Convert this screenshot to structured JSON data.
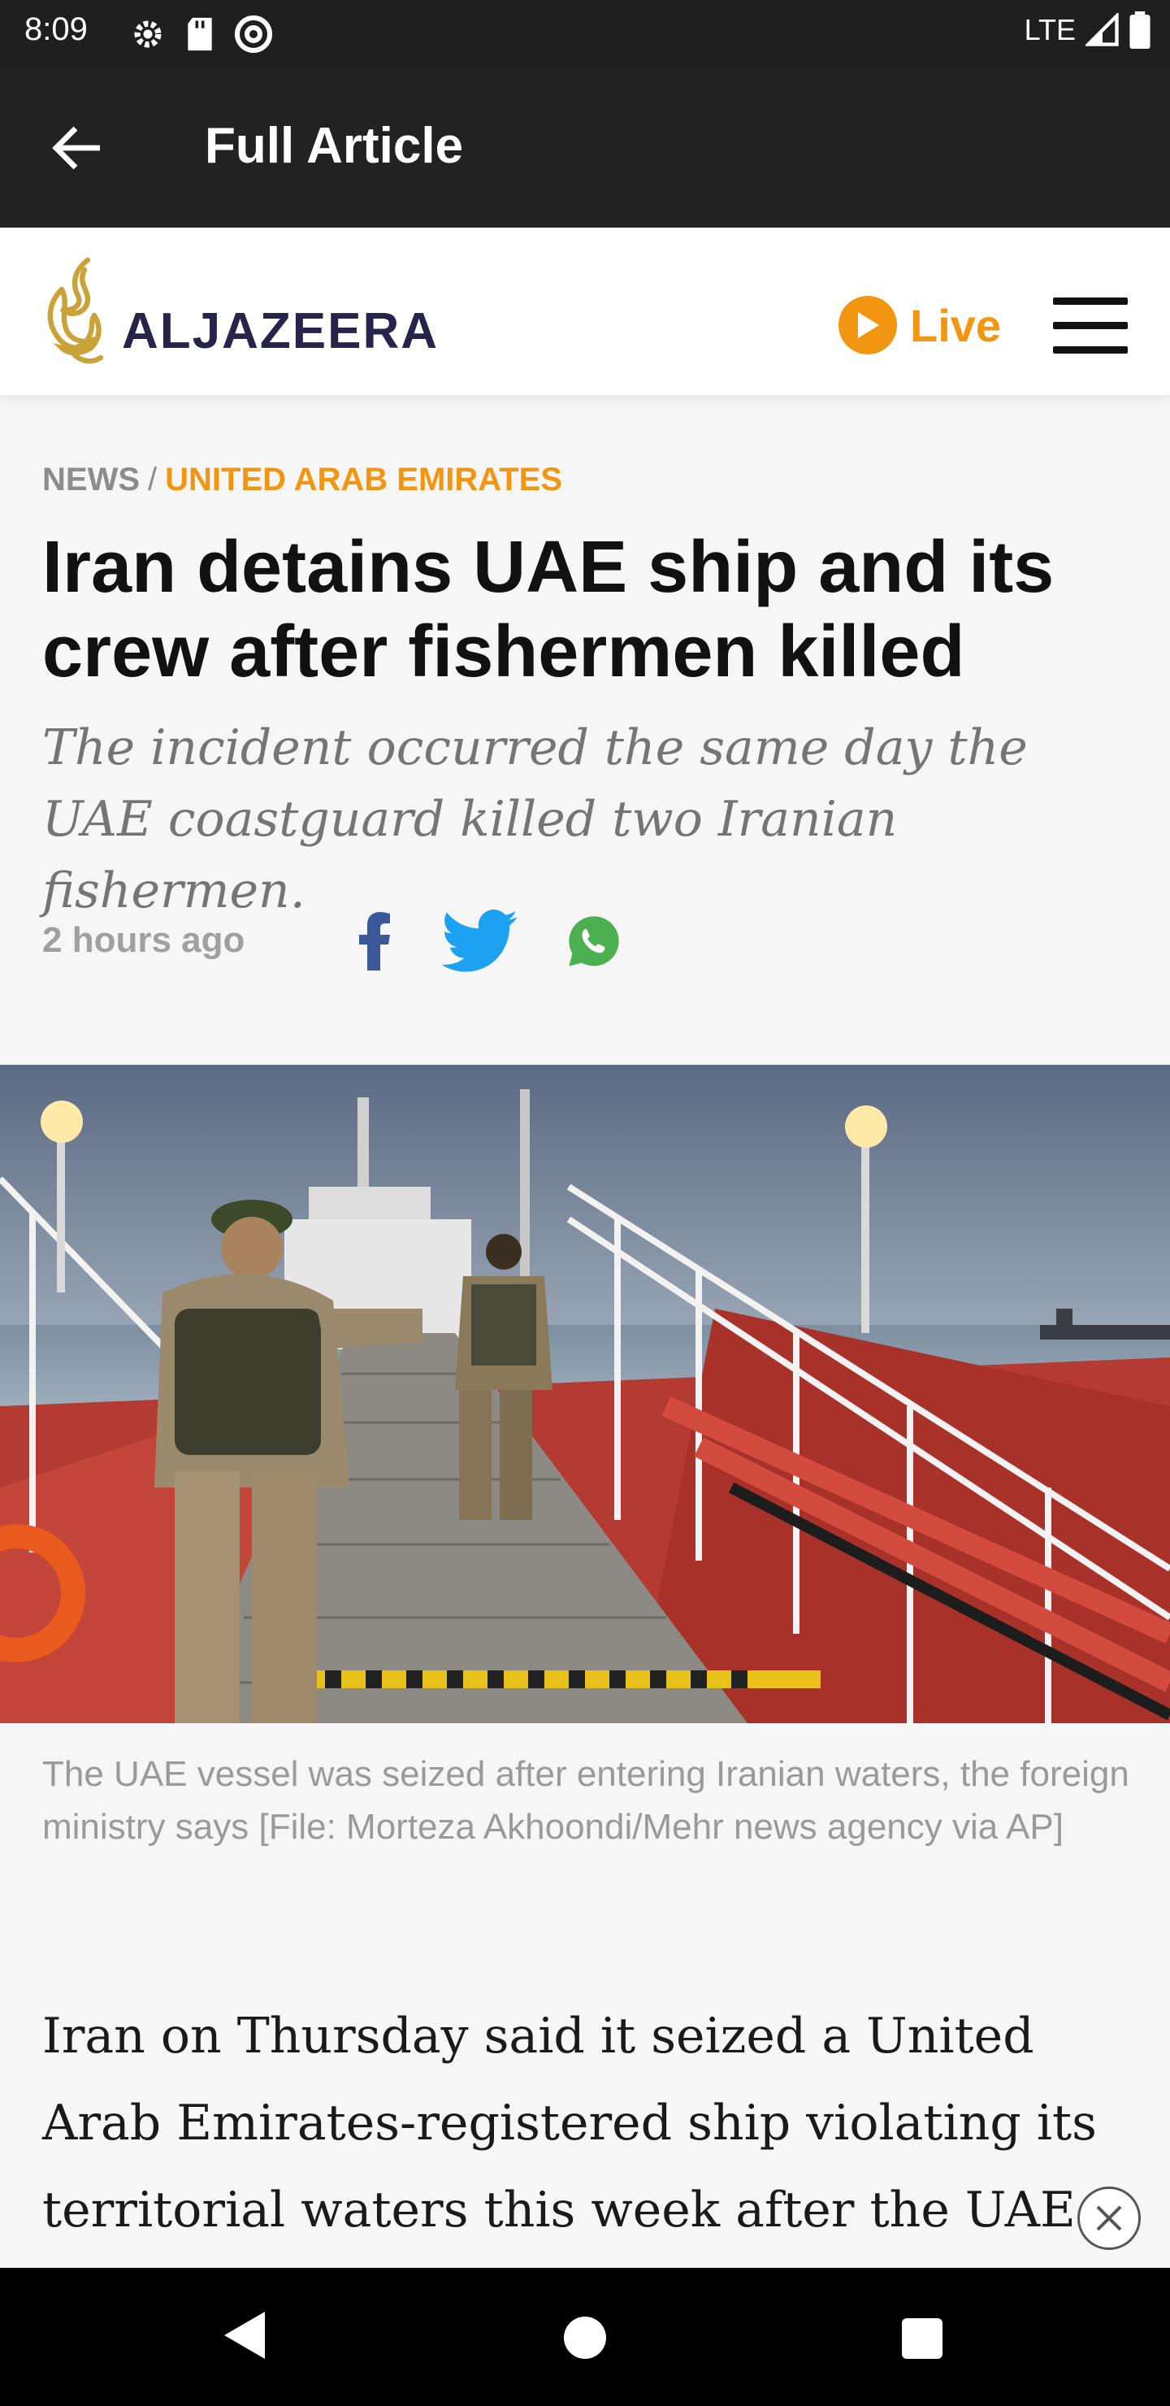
{
  "status_bar": {
    "time": "8:09",
    "network": "LTE"
  },
  "app_bar": {
    "title": "Full Article"
  },
  "site": {
    "logo_text": "ALJAZEERA",
    "live_label": "Live",
    "brand_color": "#f29612"
  },
  "article": {
    "breadcrumb_section": "NEWS",
    "breadcrumb_separator": "/",
    "breadcrumb_category": "UNITED ARAB EMIRATES",
    "headline": "Iran detains UAE ship and its crew after fishermen killed",
    "subheadline": "The incident occurred the same day the UAE coastguard killed two Iranian fishermen.",
    "timestamp": "2 hours ago",
    "share_icons": [
      "facebook-icon",
      "twitter-icon",
      "whatsapp-icon"
    ],
    "image_caption": "The UAE vessel was seized after entering Iranian waters, the foreign ministry says [File: Morteza Akhoondi/Mehr news agency via AP]",
    "body_start": "Iran on Thursday said it seized a United Arab Emirates-registered ship violating its territorial waters this week after the UAE"
  }
}
